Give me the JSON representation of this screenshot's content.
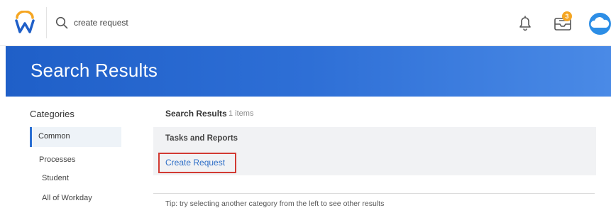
{
  "header": {
    "search": {
      "value": "create request",
      "placeholder": ""
    },
    "notifications_badge": "",
    "inbox_badge": "3",
    "icons": {
      "logo": "workday-logo",
      "search": "search-icon",
      "bell": "bell-icon",
      "inbox": "inbox-icon",
      "avatar": "cloud-avatar"
    }
  },
  "banner": {
    "title": "Search Results"
  },
  "categories": {
    "heading": "Categories",
    "items": [
      {
        "label": "Common",
        "active": true
      },
      {
        "label": "Processes",
        "active": false
      },
      {
        "label": "Student",
        "active": false
      },
      {
        "label": "All of Workday",
        "active": false
      }
    ]
  },
  "results": {
    "heading": "Search Results",
    "count": "1 items",
    "group_title": "Tasks and Reports",
    "link": "Create Request",
    "tip": "Tip: try selecting another category from the left to see other results"
  },
  "colors": {
    "brand_blue": "#2b6fd3",
    "badge_orange": "#f5a623",
    "highlight_red": "#d23a32",
    "link_blue": "#2f6fc7"
  }
}
